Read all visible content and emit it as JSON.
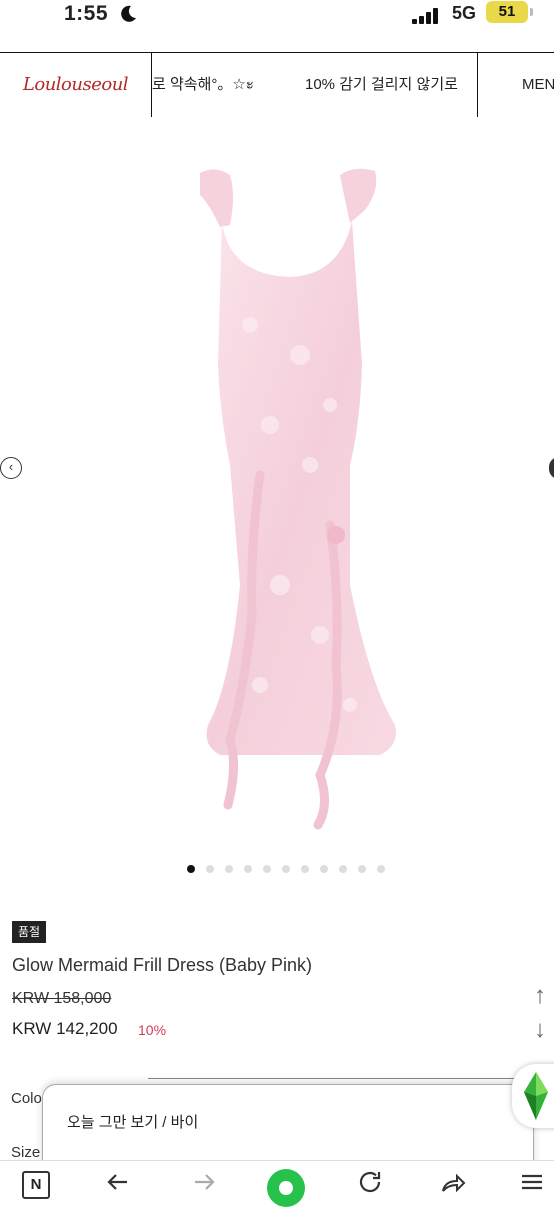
{
  "status_bar": {
    "time": "1:55",
    "network": "5G",
    "battery": "51"
  },
  "header": {
    "logo": "Loulouseoul",
    "ticker_1": "로 약속해°。☆ะ",
    "ticker_2": "10% 감기 걸리지 않기로",
    "menu_label": "MEN"
  },
  "gallery": {
    "slide_count": 11,
    "active_index": 0,
    "dress_color": "#f7d3de"
  },
  "product": {
    "badge": "품절",
    "name": "Glow Mermaid Frill Dress (Baby Pink)",
    "original_price": "KRW 158,000",
    "price": "KRW 142,200",
    "discount": "10%"
  },
  "options": {
    "color_label": "Colo",
    "size_label": "Size"
  },
  "popup": {
    "text": "오늘 그만 보기 / 바이"
  },
  "bottom_nav": {
    "n_label": "N"
  },
  "colors": {
    "accent": "#d23b57",
    "home": "#27c24c",
    "logo": "#b32a2a"
  }
}
